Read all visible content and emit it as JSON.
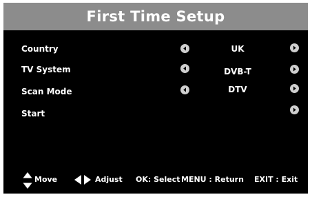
{
  "header": {
    "title": "First Time Setup"
  },
  "rows": [
    {
      "label": "Country",
      "value": "UK",
      "left_icon": "left-arrow-icon",
      "right_icon": "right-arrow-icon"
    },
    {
      "label": "TV System",
      "value": "DVB-T",
      "left_icon": "left-arrow-icon",
      "right_icon": "right-arrow-icon"
    },
    {
      "label": "Scan Mode",
      "value": "DTV",
      "left_icon": "left-arrow-icon",
      "right_icon": "right-arrow-icon"
    },
    {
      "label": "Start",
      "value": "",
      "right_icon": "right-arrow-icon"
    }
  ],
  "footer": {
    "move_label": "Move",
    "adjust_label": "Adjust",
    "ok_label": "OK: Select",
    "menu_label": "MENU : Return",
    "exit_label": "EXIT : Exit"
  },
  "colors": {
    "background": "#000000",
    "header": "#8c8c8c",
    "text": "#ffffff",
    "arrow_button": "#cfcfcf"
  }
}
